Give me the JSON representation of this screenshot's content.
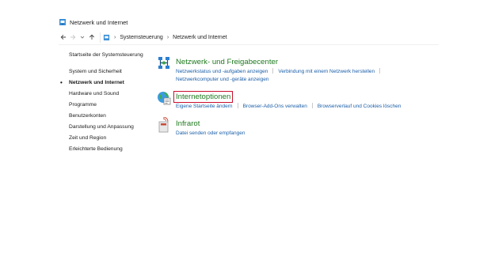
{
  "window": {
    "title": "Netzwerk und Internet"
  },
  "address_bar": {
    "crumbs": [
      "Systemsteuerung",
      "Netzwerk und Internet"
    ]
  },
  "sidebar": {
    "home_link": "Startseite der Systemsteuerung",
    "items": [
      {
        "label": "System und Sicherheit",
        "active": false
      },
      {
        "label": "Netzwerk und Internet",
        "active": true
      },
      {
        "label": "Hardware und Sound",
        "active": false
      },
      {
        "label": "Programme",
        "active": false
      },
      {
        "label": "Benutzerkonten",
        "active": false
      },
      {
        "label": "Darstellung und Anpassung",
        "active": false
      },
      {
        "label": "Zeit und Region",
        "active": false
      },
      {
        "label": "Erleichterte Bedienung",
        "active": false
      }
    ]
  },
  "categories": [
    {
      "title": "Netzwerk- und Freigabecenter",
      "icon": "network-sharing-icon",
      "links": [
        "Netzwerkstatus und -aufgaben anzeigen",
        "Verbindung mit einem Netzwerk herstellen",
        "Netzwerkcomputer und -geräte anzeigen"
      ]
    },
    {
      "title": "Internetoptionen",
      "icon": "internet-options-icon",
      "highlighted": true,
      "links": [
        "Eigene Startseite ändern",
        "Browser-Add-Ons verwalten",
        "Browserverlauf und Cookies löschen"
      ]
    },
    {
      "title": "Infrarot",
      "icon": "infrared-icon",
      "links": [
        "Datei senden oder empfangen"
      ]
    }
  ],
  "colors": {
    "category_title": "#1e7a1e",
    "link": "#1b5fa8",
    "highlight_box": "#c8102e"
  }
}
